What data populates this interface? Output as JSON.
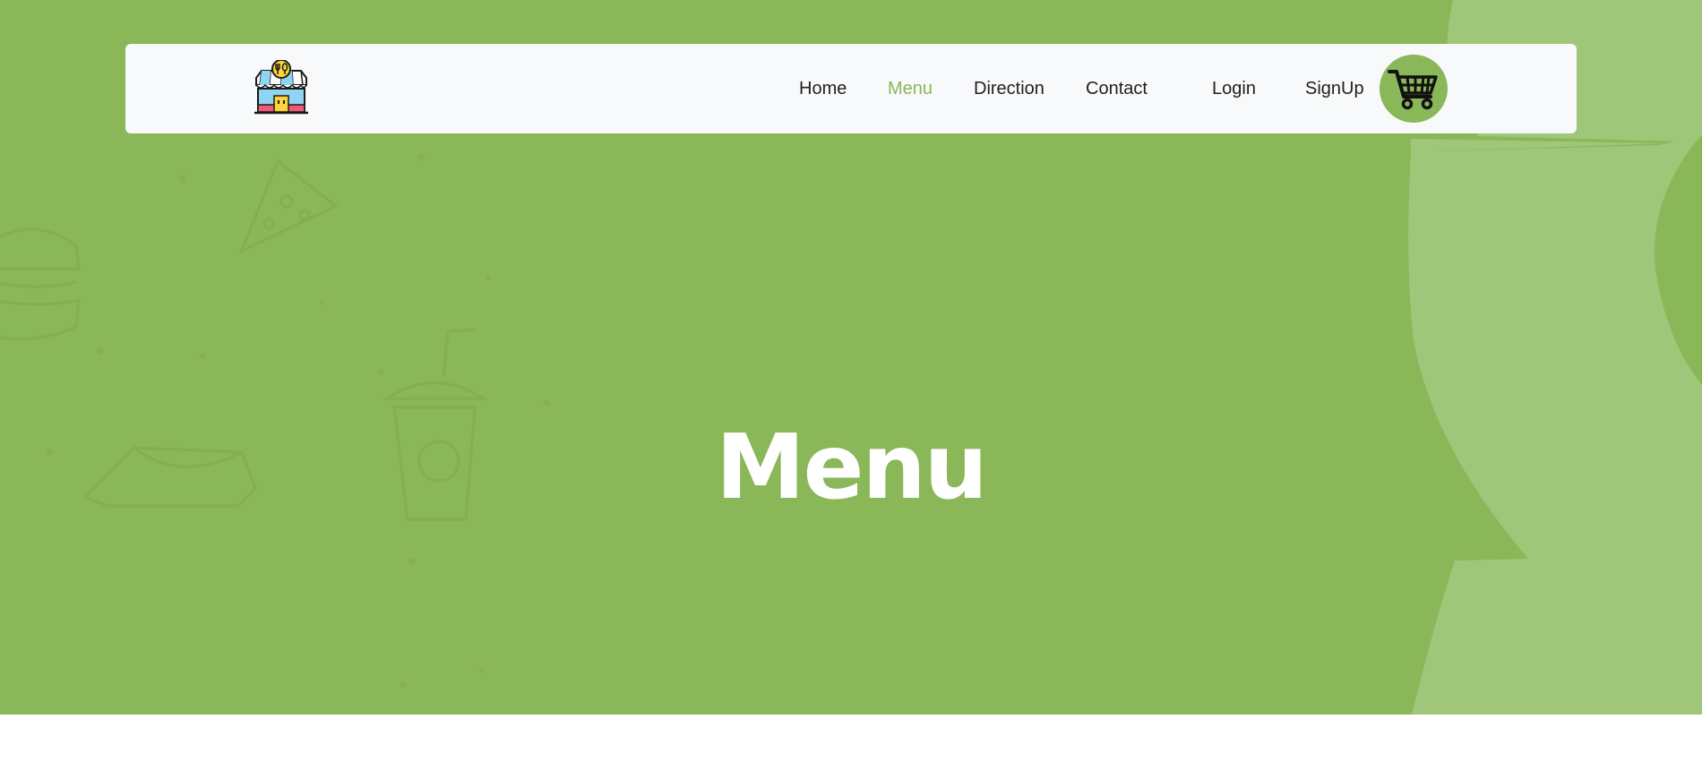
{
  "nav": {
    "links": [
      {
        "label": "Home",
        "active": false
      },
      {
        "label": "Menu",
        "active": true
      },
      {
        "label": "Direction",
        "active": false
      },
      {
        "label": "Contact",
        "active": false
      },
      {
        "label": "Login",
        "active": false
      },
      {
        "label": "SignUp",
        "active": false
      }
    ],
    "logo_icon": "restaurant-shop-icon",
    "cart_icon": "shopping-cart-icon"
  },
  "hero": {
    "title": "Menu"
  },
  "colors": {
    "accent": "#8ab758",
    "accent_light": "#a0c679",
    "navbar_bg": "#f8f9fa",
    "text_dark": "#1f1f1f",
    "white": "#ffffff"
  }
}
